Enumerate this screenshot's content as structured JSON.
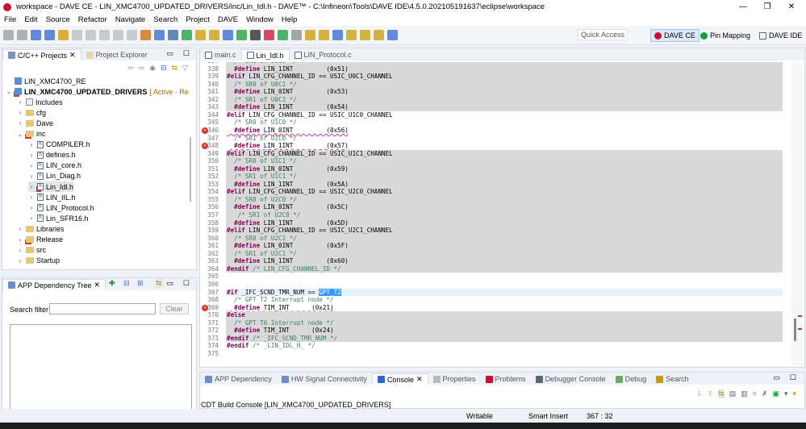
{
  "window": {
    "title": "workspace - DAVE CE - LIN_XMC4700_UPDATED_DRIVERS/inc/Lin_Idl.h - DAVE™ - C:\\Infineon\\Tools\\DAVE IDE\\4.5.0.202105191637\\eclipse\\workspace",
    "minimize": "—",
    "restore": "❐",
    "close": "✕"
  },
  "menu": [
    "File",
    "Edit",
    "Source",
    "Refactor",
    "Navigate",
    "Search",
    "Project",
    "DAVE",
    "Window",
    "Help"
  ],
  "toolbar": {
    "quick_access": "Quick Access",
    "perspectives": [
      {
        "label": "DAVE CE",
        "active": true
      },
      {
        "label": "Pin Mapping"
      },
      {
        "label": "DAVE IDE"
      }
    ]
  },
  "projects": {
    "tabs": [
      "C/C++ Projects",
      "Project Explorer"
    ],
    "tree": [
      {
        "label": "LIN_XMC4700_RE",
        "depth": 0,
        "type": "project",
        "exp": ""
      },
      {
        "label": "LIN_XMC4700_UPDATED_DRIVERS",
        "suffix": " [ Active - Re",
        "depth": 0,
        "type": "project",
        "exp": "v",
        "bold": true,
        "err": true
      },
      {
        "label": "Includes",
        "depth": 1,
        "type": "inc",
        "exp": ">"
      },
      {
        "label": "cfg",
        "depth": 1,
        "type": "folder",
        "exp": ">"
      },
      {
        "label": "Dave",
        "depth": 1,
        "type": "folder",
        "exp": ">"
      },
      {
        "label": "inc",
        "depth": 1,
        "type": "folder",
        "exp": "v",
        "err": true
      },
      {
        "label": "COMPILER.h",
        "depth": 2,
        "type": "h",
        "exp": ">"
      },
      {
        "label": "defines.h",
        "depth": 2,
        "type": "h",
        "exp": ">"
      },
      {
        "label": "LIN_core.h",
        "depth": 2,
        "type": "h",
        "exp": ">"
      },
      {
        "label": "Lin_Diag.h",
        "depth": 2,
        "type": "h",
        "exp": ">"
      },
      {
        "label": "Lin_Idl.h",
        "depth": 2,
        "type": "h",
        "exp": ">",
        "err": true,
        "selected": true
      },
      {
        "label": "LIN_IIL.h",
        "depth": 2,
        "type": "h",
        "exp": ">"
      },
      {
        "label": "LIN_Protocol.h",
        "depth": 2,
        "type": "h",
        "exp": ">"
      },
      {
        "label": "Lin_SFR16.h",
        "depth": 2,
        "type": "h",
        "exp": ">"
      },
      {
        "label": "Libraries",
        "depth": 1,
        "type": "folder",
        "exp": ">"
      },
      {
        "label": "Release",
        "depth": 1,
        "type": "folder",
        "exp": ">",
        "err": true
      },
      {
        "label": "src",
        "depth": 1,
        "type": "folder",
        "exp": ">"
      },
      {
        "label": "Startup",
        "depth": 1,
        "type": "folder",
        "exp": ">"
      }
    ]
  },
  "app_tree": {
    "title": "APP Dependency Tree",
    "search_label": "Search filter",
    "search_value": "",
    "clear": "Clear"
  },
  "editor": {
    "tabs": [
      {
        "label": "main.c"
      },
      {
        "label": "Lin_Idl.h",
        "active": true
      },
      {
        "label": "LIN_Protocol.c"
      }
    ],
    "lines": [
      {
        "n": "337",
        "bg": "gray",
        "c": "  /* SR1 of U0C0 */"
      },
      {
        "n": "338",
        "bg": "gray",
        "k": "  #define",
        "t": " LIN_1INT         (0x51)"
      },
      {
        "n": "339",
        "bg": "gray",
        "k": "#elif",
        "t": " LIN_CFG_CHANNEL_ID == USIC_U0C1_CHANNEL"
      },
      {
        "n": "340",
        "bg": "gray",
        "c": "  /* SR0 of U0C1 */"
      },
      {
        "n": "341",
        "bg": "gray",
        "k": "  #define",
        "t": " LIN_0INT         (0x53)"
      },
      {
        "n": "342",
        "bg": "gray",
        "c": "  /* SR1 of U0C1 */"
      },
      {
        "n": "343",
        "bg": "gray",
        "k": "  #define",
        "t": " LIN_1INT         (0x54)"
      },
      {
        "n": "344",
        "bg": "",
        "k": "#elif",
        "t": " LIN_CFG_CHANNEL_ID == USIC_U1C0_CHANNEL"
      },
      {
        "n": "345",
        "bg": "",
        "c": "  /* SR0 of U1C0 */"
      },
      {
        "n": "346",
        "bg": "",
        "k": "  #define",
        "t": " LIN_0INT         (0x56)",
        "err": true
      },
      {
        "n": "347",
        "bg": "",
        "c": "  /* SR1 of U1C0 */"
      },
      {
        "n": "348",
        "bg": "",
        "k": "  #define",
        "t": " LIN_1INT         (0x57)",
        "err": true
      },
      {
        "n": "349",
        "bg": "gray",
        "k": "#elif",
        "t": " LIN_CFG_CHANNEL_ID == USIC_U1C1_CHANNEL"
      },
      {
        "n": "350",
        "bg": "gray",
        "c": "  /* SR0 of U1C1 */"
      },
      {
        "n": "351",
        "bg": "gray",
        "k": "  #define",
        "t": " LIN_0INT         (0x59)"
      },
      {
        "n": "352",
        "bg": "gray",
        "c": "  /* SR1 of U1C1 */"
      },
      {
        "n": "353",
        "bg": "gray",
        "k": "  #define",
        "t": " LIN_1INT         (0x5A)"
      },
      {
        "n": "354",
        "bg": "gray",
        "k": "#elif",
        "t": " LIN_CFG_CHANNEL_ID == USIC_U2C0_CHANNEL"
      },
      {
        "n": "355",
        "bg": "gray",
        "c": "  /* SR0 of U2C0 */"
      },
      {
        "n": "356",
        "bg": "gray",
        "k": "  #define",
        "t": " LIN_0INT         (0x5C)"
      },
      {
        "n": "357",
        "bg": "gray",
        "c": "   /* SR1 of U2C0 */"
      },
      {
        "n": "358",
        "bg": "gray",
        "k": "  #define",
        "t": " LIN_1INT         (0x5D)"
      },
      {
        "n": "359",
        "bg": "gray",
        "k": "#elif",
        "t": " LIN_CFG_CHANNEL_ID == USIC_U2C1_CHANNEL"
      },
      {
        "n": "360",
        "bg": "gray",
        "c": "  /* SR0 of U2C1 */"
      },
      {
        "n": "361",
        "bg": "gray",
        "k": "  #define",
        "t": " LIN_0INT         (0x5F)"
      },
      {
        "n": "362",
        "bg": "gray",
        "c": "  /* SR1 of U2C1 */"
      },
      {
        "n": "363",
        "bg": "gray",
        "k": "  #define",
        "t": " LIN_1INT         (0x60)"
      },
      {
        "n": "364",
        "bg": "gray",
        "k": "#endif",
        "c": " /* LIN_CFG_CHANNEL_ID */"
      },
      {
        "n": "365",
        "bg": ""
      },
      {
        "n": "366",
        "bg": ""
      },
      {
        "n": "367",
        "bg": "cur",
        "k": "#if",
        "t": " _IFC_SCND_TMR_NUM == ",
        "s": "GPT_T2"
      },
      {
        "n": "368",
        "bg": "",
        "c": "  /* GPT T2 Interrupt node */"
      },
      {
        "n": "369",
        "bg": "",
        "k": "  #define",
        "t": " TIM_INT      (0x21)",
        "err": true
      },
      {
        "n": "370",
        "bg": "gray",
        "k": "#else"
      },
      {
        "n": "371",
        "bg": "gray",
        "c": "  /* GPT T6 Interrupt node */"
      },
      {
        "n": "372",
        "bg": "gray",
        "k": "  #define",
        "t": " TIM_INT      (0x24)"
      },
      {
        "n": "373",
        "bg": "gray",
        "k": "#endif",
        "c": " /* _IFC_SCND_TMR_NUM */"
      },
      {
        "n": "374",
        "bg": "",
        "k": "#endif",
        "c": " /* _LIN_IDL_H_ */"
      },
      {
        "n": "375",
        "bg": ""
      }
    ]
  },
  "bottom": {
    "tabs": [
      {
        "label": "APP Dependency"
      },
      {
        "label": "HW Signal Connectivity"
      },
      {
        "label": "Console",
        "active": true
      },
      {
        "label": "Properties"
      },
      {
        "label": "Problems"
      },
      {
        "label": "Debugger Console"
      },
      {
        "label": "Debug"
      },
      {
        "label": "Search"
      }
    ],
    "console_text": "CDT Build Console [LIN_XMC4700_UPDATED_DRIVERS]"
  },
  "status": {
    "writable": "Writable",
    "insert": "Smart Insert",
    "position": "367 : 32"
  },
  "colors": {
    "error": "#d9342b",
    "keyword": "#7f0055",
    "comment": "#3f7f5f",
    "selection": "#3399ff"
  }
}
